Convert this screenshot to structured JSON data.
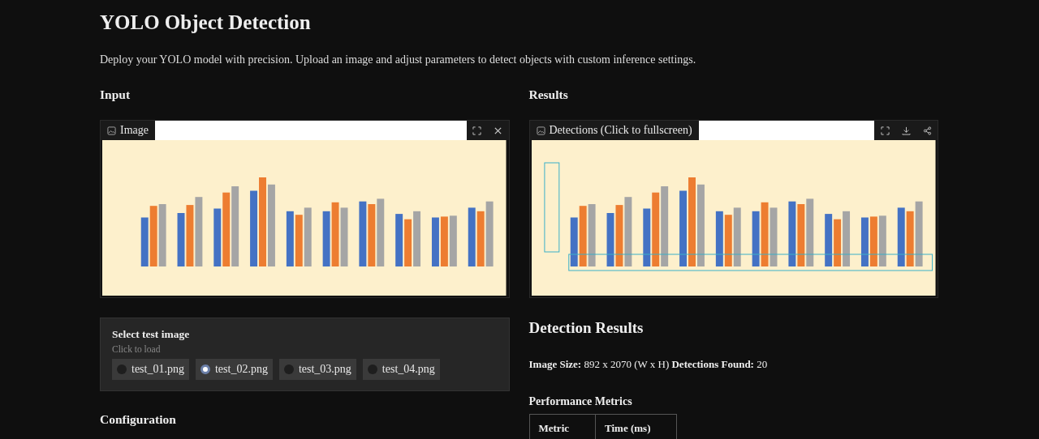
{
  "title": "YOLO Object Detection",
  "description": "Deploy your YOLO model with precision. Upload an image and adjust parameters to detect objects with custom inference settings.",
  "input": {
    "heading": "Input",
    "image_label": "Image",
    "test_images": {
      "label": "Select test image",
      "hint": "Click to load",
      "options": [
        {
          "label": "test_01.png",
          "selected": false
        },
        {
          "label": "test_02.png",
          "selected": true
        },
        {
          "label": "test_03.png",
          "selected": false
        },
        {
          "label": "test_04.png",
          "selected": false
        }
      ]
    },
    "configuration_heading": "Configuration"
  },
  "results": {
    "heading": "Results",
    "image_label": "Detections (Click to fullscreen)",
    "section_title": "Detection Results",
    "summary": "**Image Size:** 892 x 2070 (W x H) **Detections Found:** 20",
    "metrics_heading": "Performance Metrics",
    "metrics_columns": [
      "Metric",
      "Time (ms)"
    ]
  }
}
